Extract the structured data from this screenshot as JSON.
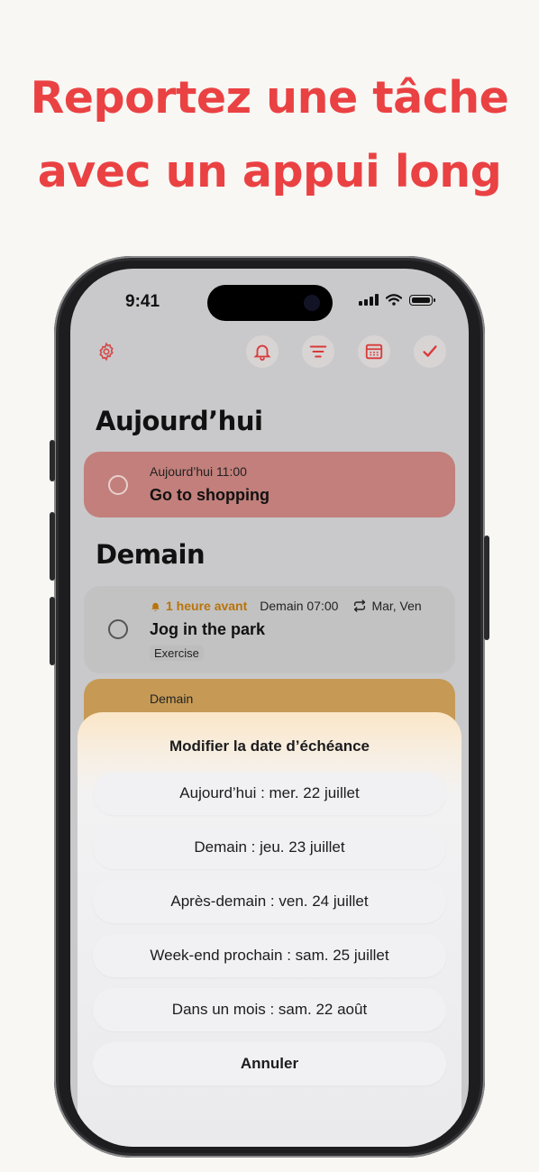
{
  "headline": {
    "line1": "Reportez une tâche",
    "line2": "avec un appui long"
  },
  "status_bar": {
    "time": "9:41"
  },
  "toolbar": {
    "icons": [
      "gear-icon",
      "bell-icon",
      "filter-icon",
      "calendar-icon",
      "checkmark-icon"
    ]
  },
  "sections": {
    "today": {
      "title": "Aujourd’hui",
      "task": {
        "meta": "Aujourd’hui 11:00",
        "title": "Go to shopping",
        "color": "#c27f7b"
      }
    },
    "tomorrow": {
      "title": "Demain",
      "task1": {
        "reminder": "1 heure avant",
        "due": "Demain 07:00",
        "repeat": "Mar, Ven",
        "title": "Jog in the park",
        "tag": "Exercise"
      },
      "task2": {
        "meta": "Demain",
        "color": "#c69a55"
      }
    }
  },
  "sheet": {
    "title": "Modifier la date d’échéance",
    "options": [
      "Aujourd’hui : mer. 22 juillet",
      "Demain : jeu. 23 juillet",
      "Après-demain : ven. 24 juillet",
      "Week-end prochain : sam. 25 juillet",
      "Dans un mois : sam. 22 août"
    ],
    "cancel": "Annuler"
  },
  "colors": {
    "accent": "#ea4143",
    "reminder": "#b9730a"
  }
}
